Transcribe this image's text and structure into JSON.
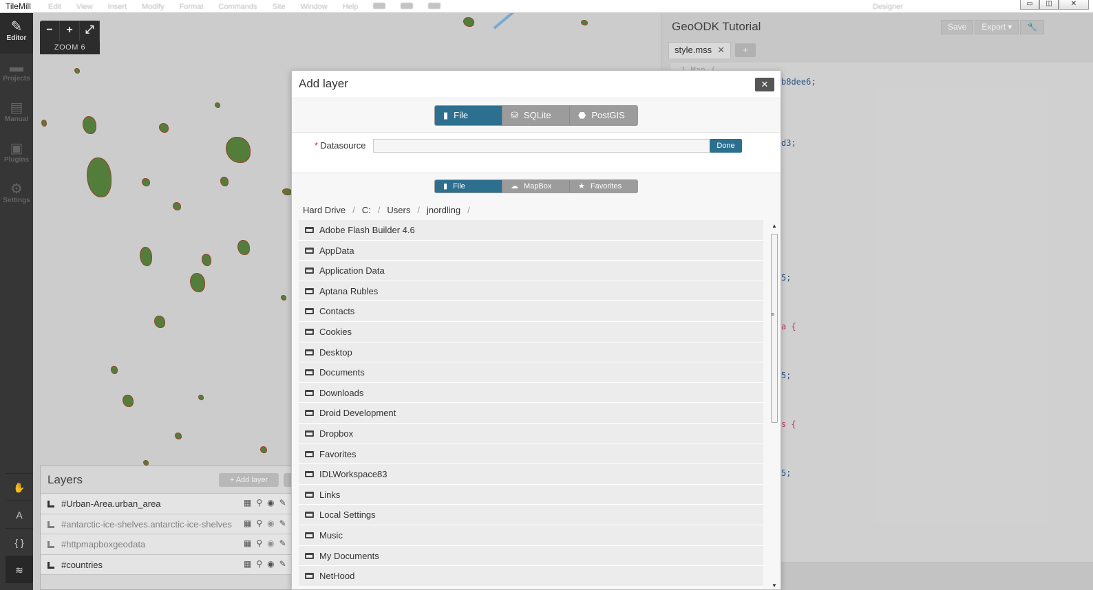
{
  "app": {
    "name": "TileMill",
    "menus": [
      "Edit",
      "View",
      "Insert",
      "Modify",
      "Format",
      "Commands",
      "Site",
      "Window",
      "Help"
    ],
    "designer": "Designer"
  },
  "window_buttons": {
    "minimize": "▭",
    "maximize": "◫",
    "close": "✕"
  },
  "sidebar": {
    "items": [
      {
        "label": "Editor",
        "icon": "pencil-icon",
        "glyph": "✎"
      },
      {
        "label": "Projects",
        "icon": "folder-icon",
        "glyph": "▬"
      },
      {
        "label": "Manual",
        "icon": "book-icon",
        "glyph": "▤"
      },
      {
        "label": "Plugins",
        "icon": "plug-icon",
        "glyph": "▣"
      },
      {
        "label": "Settings",
        "icon": "gear-icon",
        "glyph": "⚙"
      }
    ],
    "tools": [
      {
        "icon": "hand-icon",
        "glyph": "✋"
      },
      {
        "icon": "font-icon",
        "glyph": "A"
      },
      {
        "icon": "braces-icon",
        "glyph": "{ }"
      },
      {
        "icon": "layers-icon",
        "glyph": "≋"
      }
    ]
  },
  "map": {
    "zoom_minus": "−",
    "zoom_plus": "+",
    "zoom_full": "⤢",
    "zoom_label": "ZOOM 6"
  },
  "layers_panel": {
    "title": "Layers",
    "add_button": "+ Add layer",
    "rows": [
      {
        "name": "#Urban-Area.urban_area",
        "visible": true
      },
      {
        "name": "#antarctic-ice-shelves.antarctic-ice-shelves",
        "visible": false
      },
      {
        "name": "#httpmapboxgeodata",
        "visible": false
      },
      {
        "name": "#countries",
        "visible": true
      }
    ],
    "action_glyphs": {
      "table": "▦",
      "search": "⚲",
      "eye": "◉",
      "edit": "✎"
    }
  },
  "editor": {
    "project_title": "GeoODK Tutorial",
    "save_label": "Save",
    "export_label": "Export",
    "export_caret": "▾",
    "wrench": "🔧",
    "tab_label": "style.mss",
    "tab_close": "✕",
    "add_tab": "+",
    "code_fragments": [
      {
        "text": "b8dee6;",
        "pink": false
      },
      {
        "text": "d3;",
        "pink": false
      },
      {
        "text": "5;",
        "pink": false
      },
      {
        "text": "a {",
        "pink": true
      },
      {
        "text": "5;",
        "pink": false
      },
      {
        "text": "s {",
        "pink": true
      },
      {
        "text": "5;",
        "pink": false
      }
    ],
    "code_top_line": "1 Map {"
  },
  "modal": {
    "title": "Add layer",
    "close": "✕",
    "source_tabs": [
      {
        "label": "File",
        "glyph": "▮",
        "active": true
      },
      {
        "label": "SQLite",
        "glyph": "⛁",
        "active": false
      },
      {
        "label": "PostGIS",
        "glyph": "⬣",
        "active": false
      }
    ],
    "datasource_required": "*",
    "datasource_label": "Datasource",
    "datasource_value": "",
    "done_label": "Done",
    "browse_tabs": [
      {
        "label": "File",
        "glyph": "▮",
        "active": true
      },
      {
        "label": "MapBox",
        "glyph": "☁",
        "active": false
      },
      {
        "label": "Favorites",
        "glyph": "★",
        "active": false
      }
    ],
    "breadcrumb": [
      "Hard Drive",
      "C:",
      "Users",
      "jnordling"
    ],
    "breadcrumb_sep": "/",
    "folders": [
      "Adobe Flash Builder 4.6",
      "AppData",
      "Application Data",
      "Aptana Rubles",
      "Contacts",
      "Cookies",
      "Desktop",
      "Documents",
      "Downloads",
      "Droid Development",
      "Dropbox",
      "Favorites",
      "IDLWorkspace83",
      "Links",
      "Local Settings",
      "Music",
      "My Documents",
      "NetHood"
    ],
    "scroll_up": "▲",
    "scroll_down": "▼",
    "scroll_grip": "≡"
  }
}
